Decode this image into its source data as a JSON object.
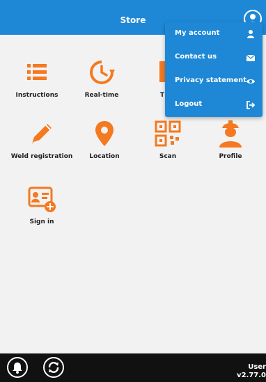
{
  "header": {
    "title": "Store",
    "bg_color": "#1e88d6",
    "avatar_icon": "user-circle-icon"
  },
  "grid": {
    "accent_color": "#f47920",
    "items": [
      {
        "label": "Instructions",
        "icon": "list-icon"
      },
      {
        "label": "Real-time",
        "icon": "clock-refresh-icon"
      },
      {
        "label": "T",
        "icon": "document-icon"
      },
      {
        "label": "Weld registration",
        "icon": "pencil-icon"
      },
      {
        "label": "Location",
        "icon": "map-pin-icon"
      },
      {
        "label": "Scan",
        "icon": "qr-code-icon"
      },
      {
        "label": "Profile",
        "icon": "worker-helmet-icon"
      },
      {
        "label": "Sign in",
        "icon": "id-card-add-icon"
      }
    ]
  },
  "menu": {
    "items": [
      {
        "label": "My account",
        "icon": "user-icon"
      },
      {
        "label": "Contact us",
        "icon": "envelope-icon"
      },
      {
        "label": "Privacy statement",
        "icon": "eye-icon"
      },
      {
        "label": "Logout",
        "icon": "logout-icon"
      }
    ]
  },
  "footer": {
    "bell_icon": "bell-icon",
    "sync_icon": "sync-icon",
    "user_label": "User",
    "version": "v2.77.0"
  }
}
